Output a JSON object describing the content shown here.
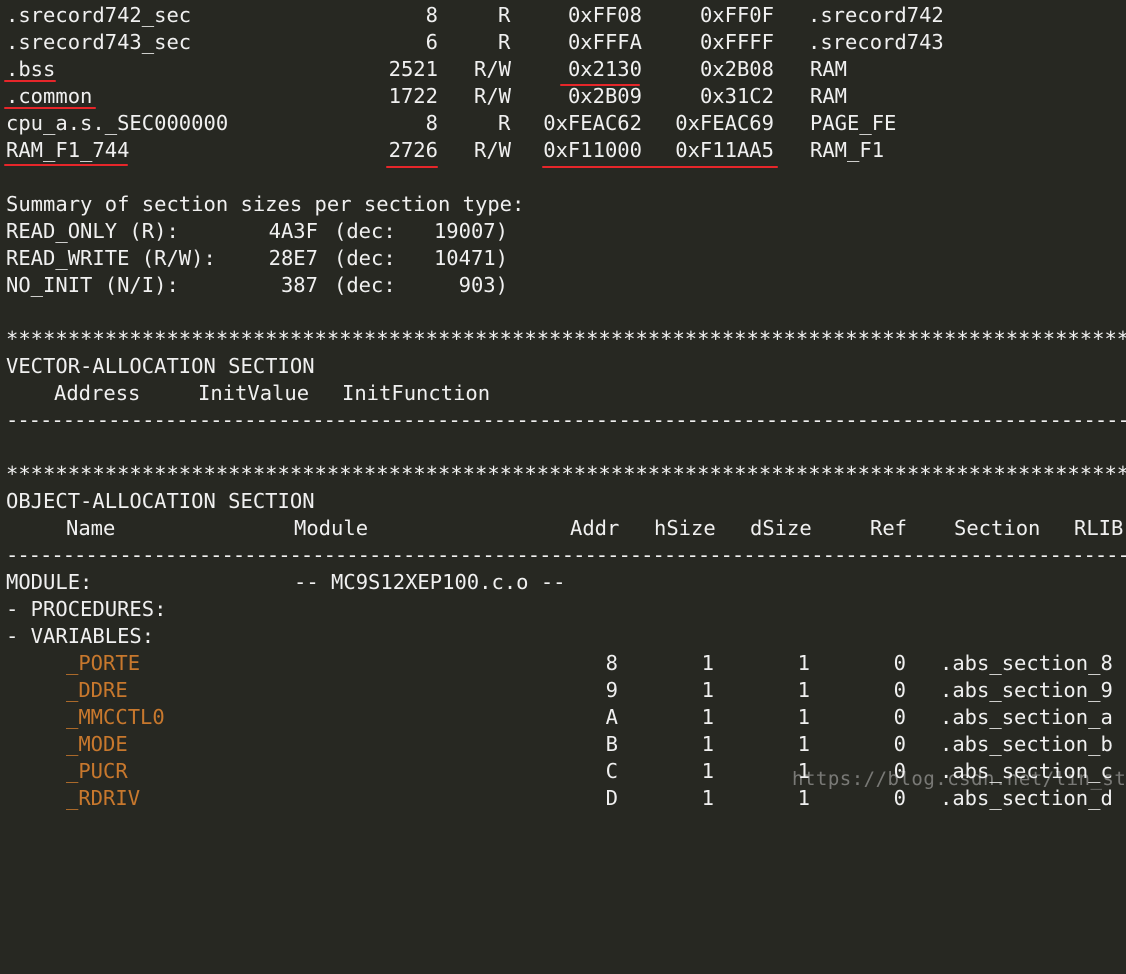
{
  "section_rows": [
    {
      "name": ".srecord742_sec",
      "size": "8",
      "type": "R",
      "from": "0xFF08",
      "to": "0xFF0F",
      "segment": ".srecord742"
    },
    {
      "name": ".srecord743_sec",
      "size": "6",
      "type": "R",
      "from": "0xFFFA",
      "to": "0xFFFF",
      "segment": ".srecord743"
    },
    {
      "name": ".bss",
      "size": "2521",
      "type": "R/W",
      "from": "0x2130",
      "to": "0x2B08",
      "segment": "RAM"
    },
    {
      "name": ".common",
      "size": "1722",
      "type": "R/W",
      "from": "0x2B09",
      "to": "0x31C2",
      "segment": "RAM"
    },
    {
      "name": "cpu_a.s._SEC000000",
      "size": "8",
      "type": "R",
      "from": "0xFEAC62",
      "to": "0xFEAC69",
      "segment": "PAGE_FE"
    },
    {
      "name": "RAM_F1_744",
      "size": "2726",
      "type": "R/W",
      "from": "0xF11000",
      "to": "0xF11AA5",
      "segment": "RAM_F1"
    }
  ],
  "summary": {
    "heading": "Summary of section sizes per section type:",
    "rows": [
      {
        "label": "READ_ONLY (R):",
        "hex": "4A3F",
        "dec_label": "(dec:",
        "dec": "19007)"
      },
      {
        "label": "READ_WRITE (R/W):",
        "hex": "28E7",
        "dec_label": "(dec:",
        "dec": "10471)"
      },
      {
        "label": "NO_INIT (N/I):",
        "hex": "387",
        "dec_label": "(dec:",
        "dec": "903)"
      }
    ]
  },
  "separator_stars": "****************************************************************************************************************************",
  "separator_dashes": "------------------------------------------------------------------------------------------------------------------------------------------------",
  "vector_section": {
    "title": "VECTOR-ALLOCATION SECTION",
    "headers": [
      "Address",
      "InitValue",
      "InitFunction"
    ]
  },
  "object_section": {
    "title": "OBJECT-ALLOCATION SECTION",
    "headers": [
      "Name",
      "Module",
      "Addr",
      "hSize",
      "dSize",
      "Ref",
      "Section",
      "RLIB"
    ],
    "module_label": "MODULE:",
    "module_name": "-- MC9S12XEP100.c.o --",
    "procedures_label": "- PROCEDURES:",
    "variables_label": "- VARIABLES:",
    "variables": [
      {
        "name": "_PORTE",
        "addr": "8",
        "hsize": "1",
        "dsize": "1",
        "ref": "0",
        "section": ".abs_section_8"
      },
      {
        "name": "_DDRE",
        "addr": "9",
        "hsize": "1",
        "dsize": "1",
        "ref": "0",
        "section": ".abs_section_9"
      },
      {
        "name": "_MMCCTL0",
        "addr": "A",
        "hsize": "1",
        "dsize": "1",
        "ref": "0",
        "section": ".abs_section_a"
      },
      {
        "name": "_MODE",
        "addr": "B",
        "hsize": "1",
        "dsize": "1",
        "ref": "0",
        "section": ".abs_section_b"
      },
      {
        "name": "_PUCR",
        "addr": "C",
        "hsize": "1",
        "dsize": "1",
        "ref": "0",
        "section": ".abs_section_c"
      },
      {
        "name": "_RDRIV",
        "addr": "D",
        "hsize": "1",
        "dsize": "1",
        "ref": "0",
        "section": ".abs_section_d"
      }
    ]
  },
  "watermark": "https://blog.csdn.net/lin_strong",
  "colors": {
    "background": "#272822",
    "text": "#f0f0f0",
    "variable_name": "#c8782d",
    "annotation_underline": "#e6262a"
  }
}
